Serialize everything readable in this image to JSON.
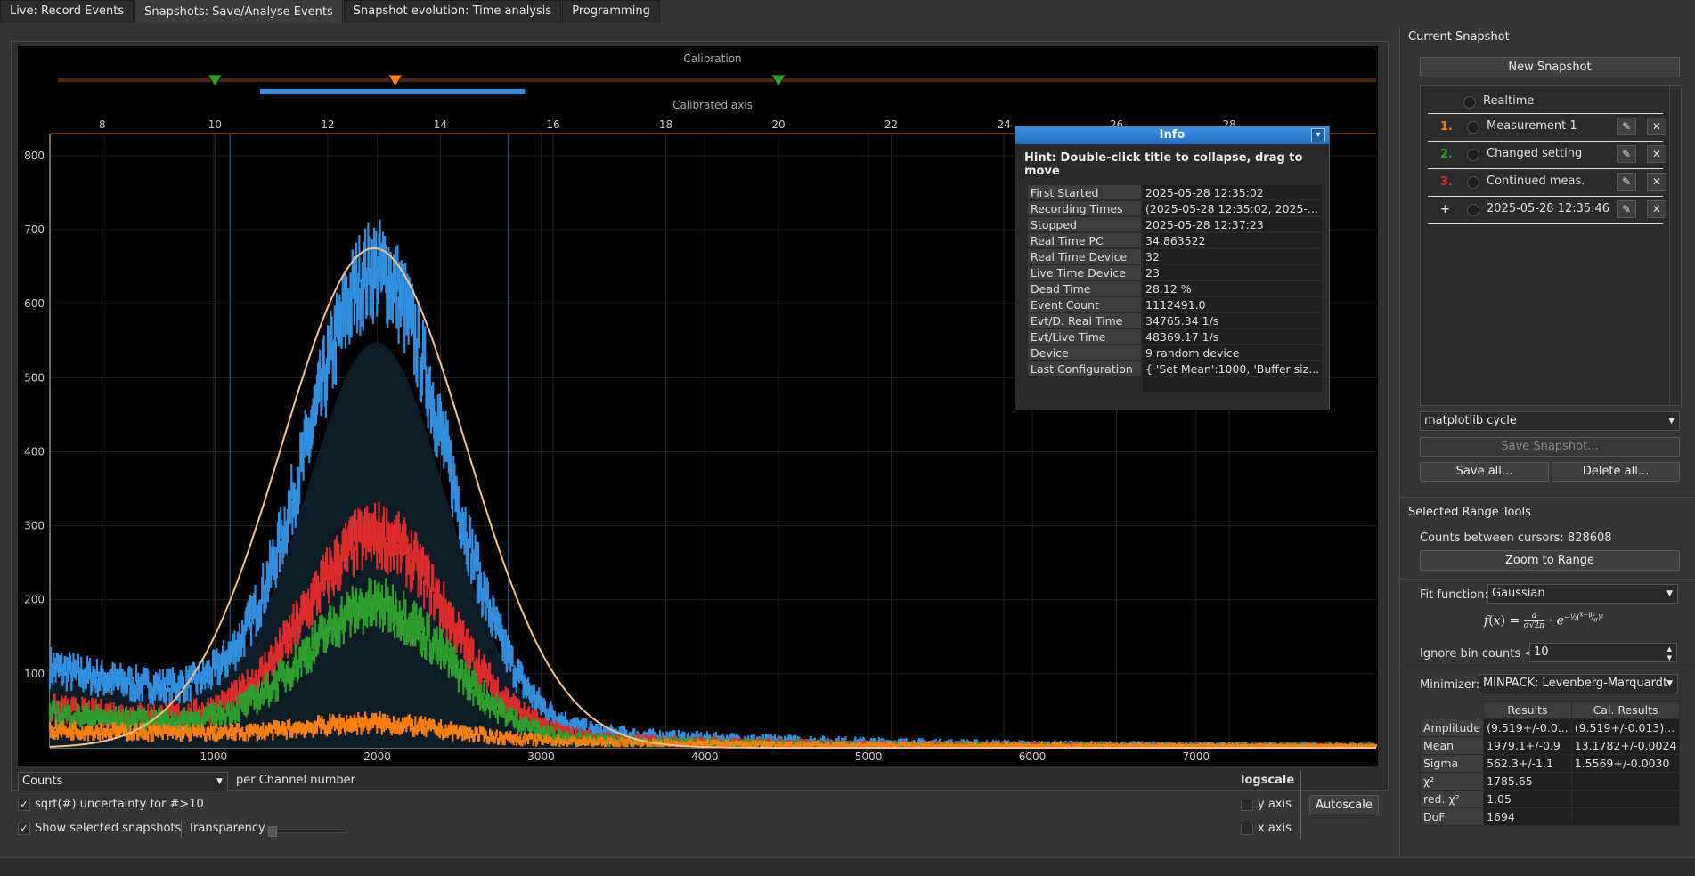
{
  "tabs": [
    "Live: Record Events",
    "Snapshots: Save/Analyse Events",
    "Snapshot evolution: Time analysis",
    "Programming"
  ],
  "active_tab": 1,
  "plot": {
    "calibration_label": "Calibration",
    "calibrated_axis_label": "Calibrated axis",
    "top_ticks": [
      "8",
      "10",
      "12",
      "14",
      "16",
      "18",
      "20",
      "22",
      "24",
      "26",
      "28"
    ],
    "y_ticks": [
      "100",
      "200",
      "300",
      "400",
      "500",
      "600",
      "700",
      "800"
    ],
    "x_ticks": [
      "1000",
      "2000",
      "3000",
      "4000",
      "5000",
      "6000",
      "7000"
    ]
  },
  "chart_data": {
    "type": "scatter",
    "x_range": [
      0,
      8100
    ],
    "y_range": [
      0,
      830
    ],
    "x_ticks": [
      1000,
      2000,
      3000,
      4000,
      5000,
      6000,
      7000
    ],
    "y_ticks": [
      100,
      200,
      300,
      400,
      500,
      600,
      700,
      800
    ],
    "calibrated_x_ticks": [
      8,
      10,
      12,
      14,
      16,
      18,
      20,
      22,
      24,
      26,
      28
    ],
    "series": [
      {
        "color": "#2f8fe0",
        "peak_x": 2000,
        "peak_y": 680
      },
      {
        "color": "#e02b2b",
        "peak_x": 2000,
        "peak_y": 300
      },
      {
        "color": "#2ca02c",
        "peak_x": 2000,
        "peak_y": 200
      },
      {
        "color": "#ff7f0e",
        "peak_x": 2000,
        "peak_y": 40
      }
    ],
    "fit": {
      "color": "#f3c48a",
      "mean": 1979.1,
      "sigma": 562.3,
      "peak_y": 675
    },
    "cursors_x": [
      1100,
      2800
    ],
    "calibration_markers": [
      10,
      13.2,
      20
    ]
  },
  "info": {
    "title": "Info",
    "hint": "Hint: Double-click title to collapse, drag to move",
    "rows": [
      {
        "k": "First Started",
        "v": "2025-05-28 12:35:02"
      },
      {
        "k": "Recording Times",
        "v": "(2025-05-28 12:35:02, 2025-..."
      },
      {
        "k": "Stopped",
        "v": "2025-05-28 12:37:23"
      },
      {
        "k": "Real Time PC",
        "v": "34.863522"
      },
      {
        "k": "Real Time Device",
        "v": "32"
      },
      {
        "k": "Live Time Device",
        "v": "23"
      },
      {
        "k": "Dead Time",
        "v": "28.12 %"
      },
      {
        "k": "Event Count",
        "v": "1112491.0"
      },
      {
        "k": "Evt/D. Real Time",
        "v": "34765.34 1/s"
      },
      {
        "k": "Evt/Live Time",
        "v": "48369.17 1/s"
      },
      {
        "k": "Device",
        "v": "9 random device"
      },
      {
        "k": "Last Configuration",
        "v": "{ 'Set Mean':1000, 'Buffer siz..."
      }
    ]
  },
  "controls": {
    "counts_select": "Counts",
    "per_channel": "per Channel number",
    "sqrt_uncertainty": "sqrt(#) uncertainty for #>10",
    "show_selected": "Show selected snapshots",
    "transparency": "Transparency",
    "logscale": "logscale",
    "y_axis": "y axis",
    "x_axis": "x axis",
    "autoscale": "Autoscale"
  },
  "sidebar": {
    "current_snapshot": "Current Snapshot",
    "new_snapshot": "New Snapshot",
    "realtime": "Realtime",
    "snapshots": [
      {
        "num": "1.",
        "color": "#ff7f0e",
        "label": "Measurement 1"
      },
      {
        "num": "2.",
        "color": "#2ca02c",
        "label": "Changed setting"
      },
      {
        "num": "3.",
        "color": "#e02b2b",
        "label": "Continued meas."
      },
      {
        "num": "+",
        "color": "#e0e0e0",
        "label": "2025-05-28 12:35:46"
      }
    ],
    "color_cycle": "matplotlib cycle",
    "save_snapshot": "Save Snapshot...",
    "save_all": "Save all...",
    "delete_all": "Delete all...",
    "range_tools": "Selected Range Tools",
    "counts_between": "Counts between cursors: 828608",
    "zoom_to_range": "Zoom to Range",
    "fit_function_label": "Fit function:",
    "fit_function": "Gaussian",
    "ignore_label": "Ignore bin counts <",
    "ignore_value": "10",
    "minimizer_label": "Minimizer:",
    "minimizer": "MINPACK: Levenberg-Marquardt",
    "results_header": "Results",
    "cal_results_header": "Cal. Results",
    "results": [
      {
        "k": "Amplitude",
        "r": "(9.519+/-0.0...",
        "c": "(9.519+/-0.013)..."
      },
      {
        "k": "Mean",
        "r": "1979.1+/-0.9",
        "c": "13.1782+/-0.0024"
      },
      {
        "k": "Sigma",
        "r": "562.3+/-1.1",
        "c": "1.5569+/-0.0030"
      },
      {
        "k": "χ²",
        "r": "1785.65",
        "c": ""
      },
      {
        "k": "red. χ²",
        "r": "1.05",
        "c": ""
      },
      {
        "k": "DoF",
        "r": "1694",
        "c": ""
      }
    ]
  }
}
